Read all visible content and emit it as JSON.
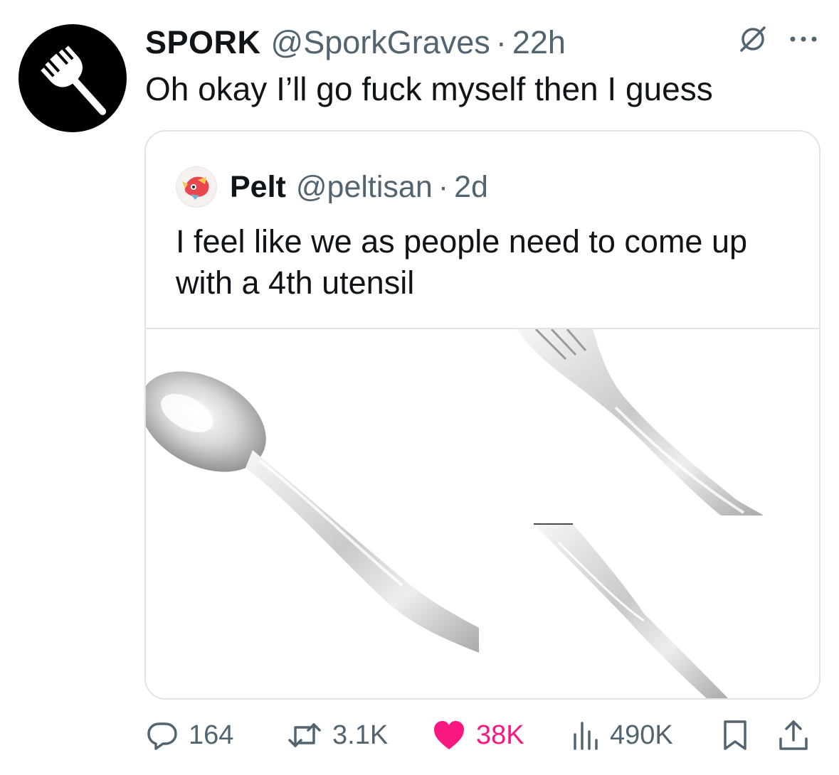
{
  "tweet": {
    "display_name": "SPORK",
    "handle": "@SporkGraves",
    "separator": "·",
    "time": "22h",
    "text": "Oh okay I’ll go fuck myself then I guess"
  },
  "quoted_tweet": {
    "display_name": "Pelt",
    "handle": "@peltisan",
    "separator": "·",
    "time": "2d",
    "text": "I feel like we as people need to come up with a 4th utensil"
  },
  "actions": {
    "replies": "164",
    "retweets": "3.1K",
    "likes": "38K",
    "views": "490K"
  },
  "icons": {
    "header": [
      "grok-slash-icon",
      "more-options-icon"
    ],
    "actions": [
      "reply-icon",
      "retweet-icon",
      "heart-icon",
      "views-icon",
      "bookmark-icon",
      "share-icon"
    ]
  },
  "colors": {
    "like": "#f91880",
    "secondary_text": "#536471",
    "primary_text": "#0f1419",
    "border": "#dfe4e8"
  }
}
